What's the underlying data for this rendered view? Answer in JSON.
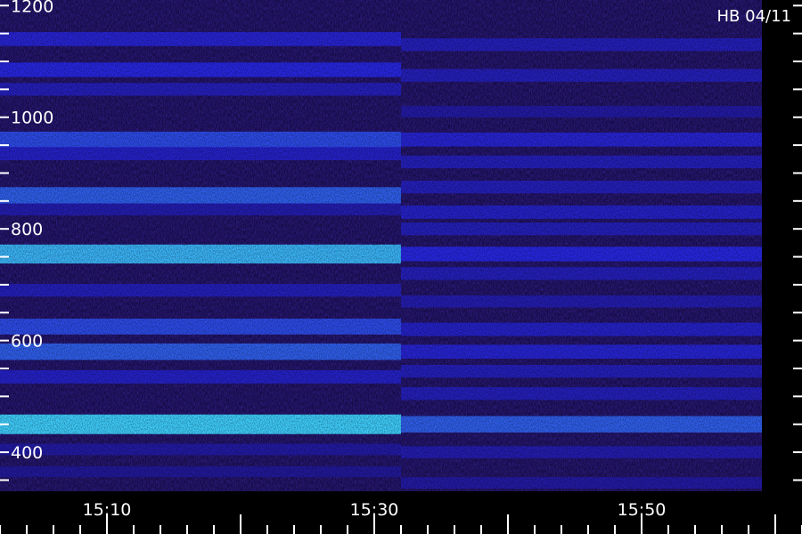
{
  "chart_data": {
    "type": "heatmap",
    "title": "",
    "annotation": "HB 04/11",
    "xlabel": "",
    "ylabel": "",
    "x_ticks": [
      "15:10",
      "15:30",
      "15:50"
    ],
    "y_ticks": [
      400,
      600,
      800,
      1000,
      1200
    ],
    "ylim": [
      330,
      1200
    ],
    "xlim": [
      "15:02",
      "15:62"
    ],
    "segments": [
      {
        "name": "",
        "x_range": [
          "15:02",
          "15:32"
        ],
        "bands": [
          {
            "y": 1140,
            "intensity": 0.55
          },
          {
            "y": 1085,
            "intensity": 0.6
          },
          {
            "y": 1050,
            "intensity": 0.45
          },
          {
            "y": 960,
            "intensity": 0.7
          },
          {
            "y": 935,
            "intensity": 0.5
          },
          {
            "y": 860,
            "intensity": 0.75
          },
          {
            "y": 835,
            "intensity": 0.4
          },
          {
            "y": 755,
            "intensity": 0.95
          },
          {
            "y": 690,
            "intensity": 0.45
          },
          {
            "y": 625,
            "intensity": 0.7
          },
          {
            "y": 580,
            "intensity": 0.75
          },
          {
            "y": 535,
            "intensity": 0.5
          },
          {
            "y": 450,
            "intensity": 1.0
          },
          {
            "y": 405,
            "intensity": 0.35
          },
          {
            "y": 365,
            "intensity": 0.3
          }
        ]
      },
      {
        "name": "",
        "x_range": [
          "15:32",
          "15:59"
        ],
        "bands": [
          {
            "y": 1130,
            "intensity": 0.45
          },
          {
            "y": 1075,
            "intensity": 0.45
          },
          {
            "y": 1010,
            "intensity": 0.35
          },
          {
            "y": 960,
            "intensity": 0.55
          },
          {
            "y": 920,
            "intensity": 0.45
          },
          {
            "y": 875,
            "intensity": 0.45
          },
          {
            "y": 830,
            "intensity": 0.5
          },
          {
            "y": 800,
            "intensity": 0.45
          },
          {
            "y": 755,
            "intensity": 0.6
          },
          {
            "y": 720,
            "intensity": 0.45
          },
          {
            "y": 670,
            "intensity": 0.4
          },
          {
            "y": 620,
            "intensity": 0.5
          },
          {
            "y": 580,
            "intensity": 0.55
          },
          {
            "y": 545,
            "intensity": 0.45
          },
          {
            "y": 505,
            "intensity": 0.45
          },
          {
            "y": 450,
            "intensity": 0.75
          },
          {
            "y": 400,
            "intensity": 0.4
          },
          {
            "y": 345,
            "intensity": 0.35
          }
        ]
      }
    ],
    "colors": {
      "background": "#000000",
      "low": "#1a0a66",
      "mid": "#2a2cff",
      "high": "#3fd0ff",
      "axis": "#ffffff"
    },
    "grid": false
  }
}
